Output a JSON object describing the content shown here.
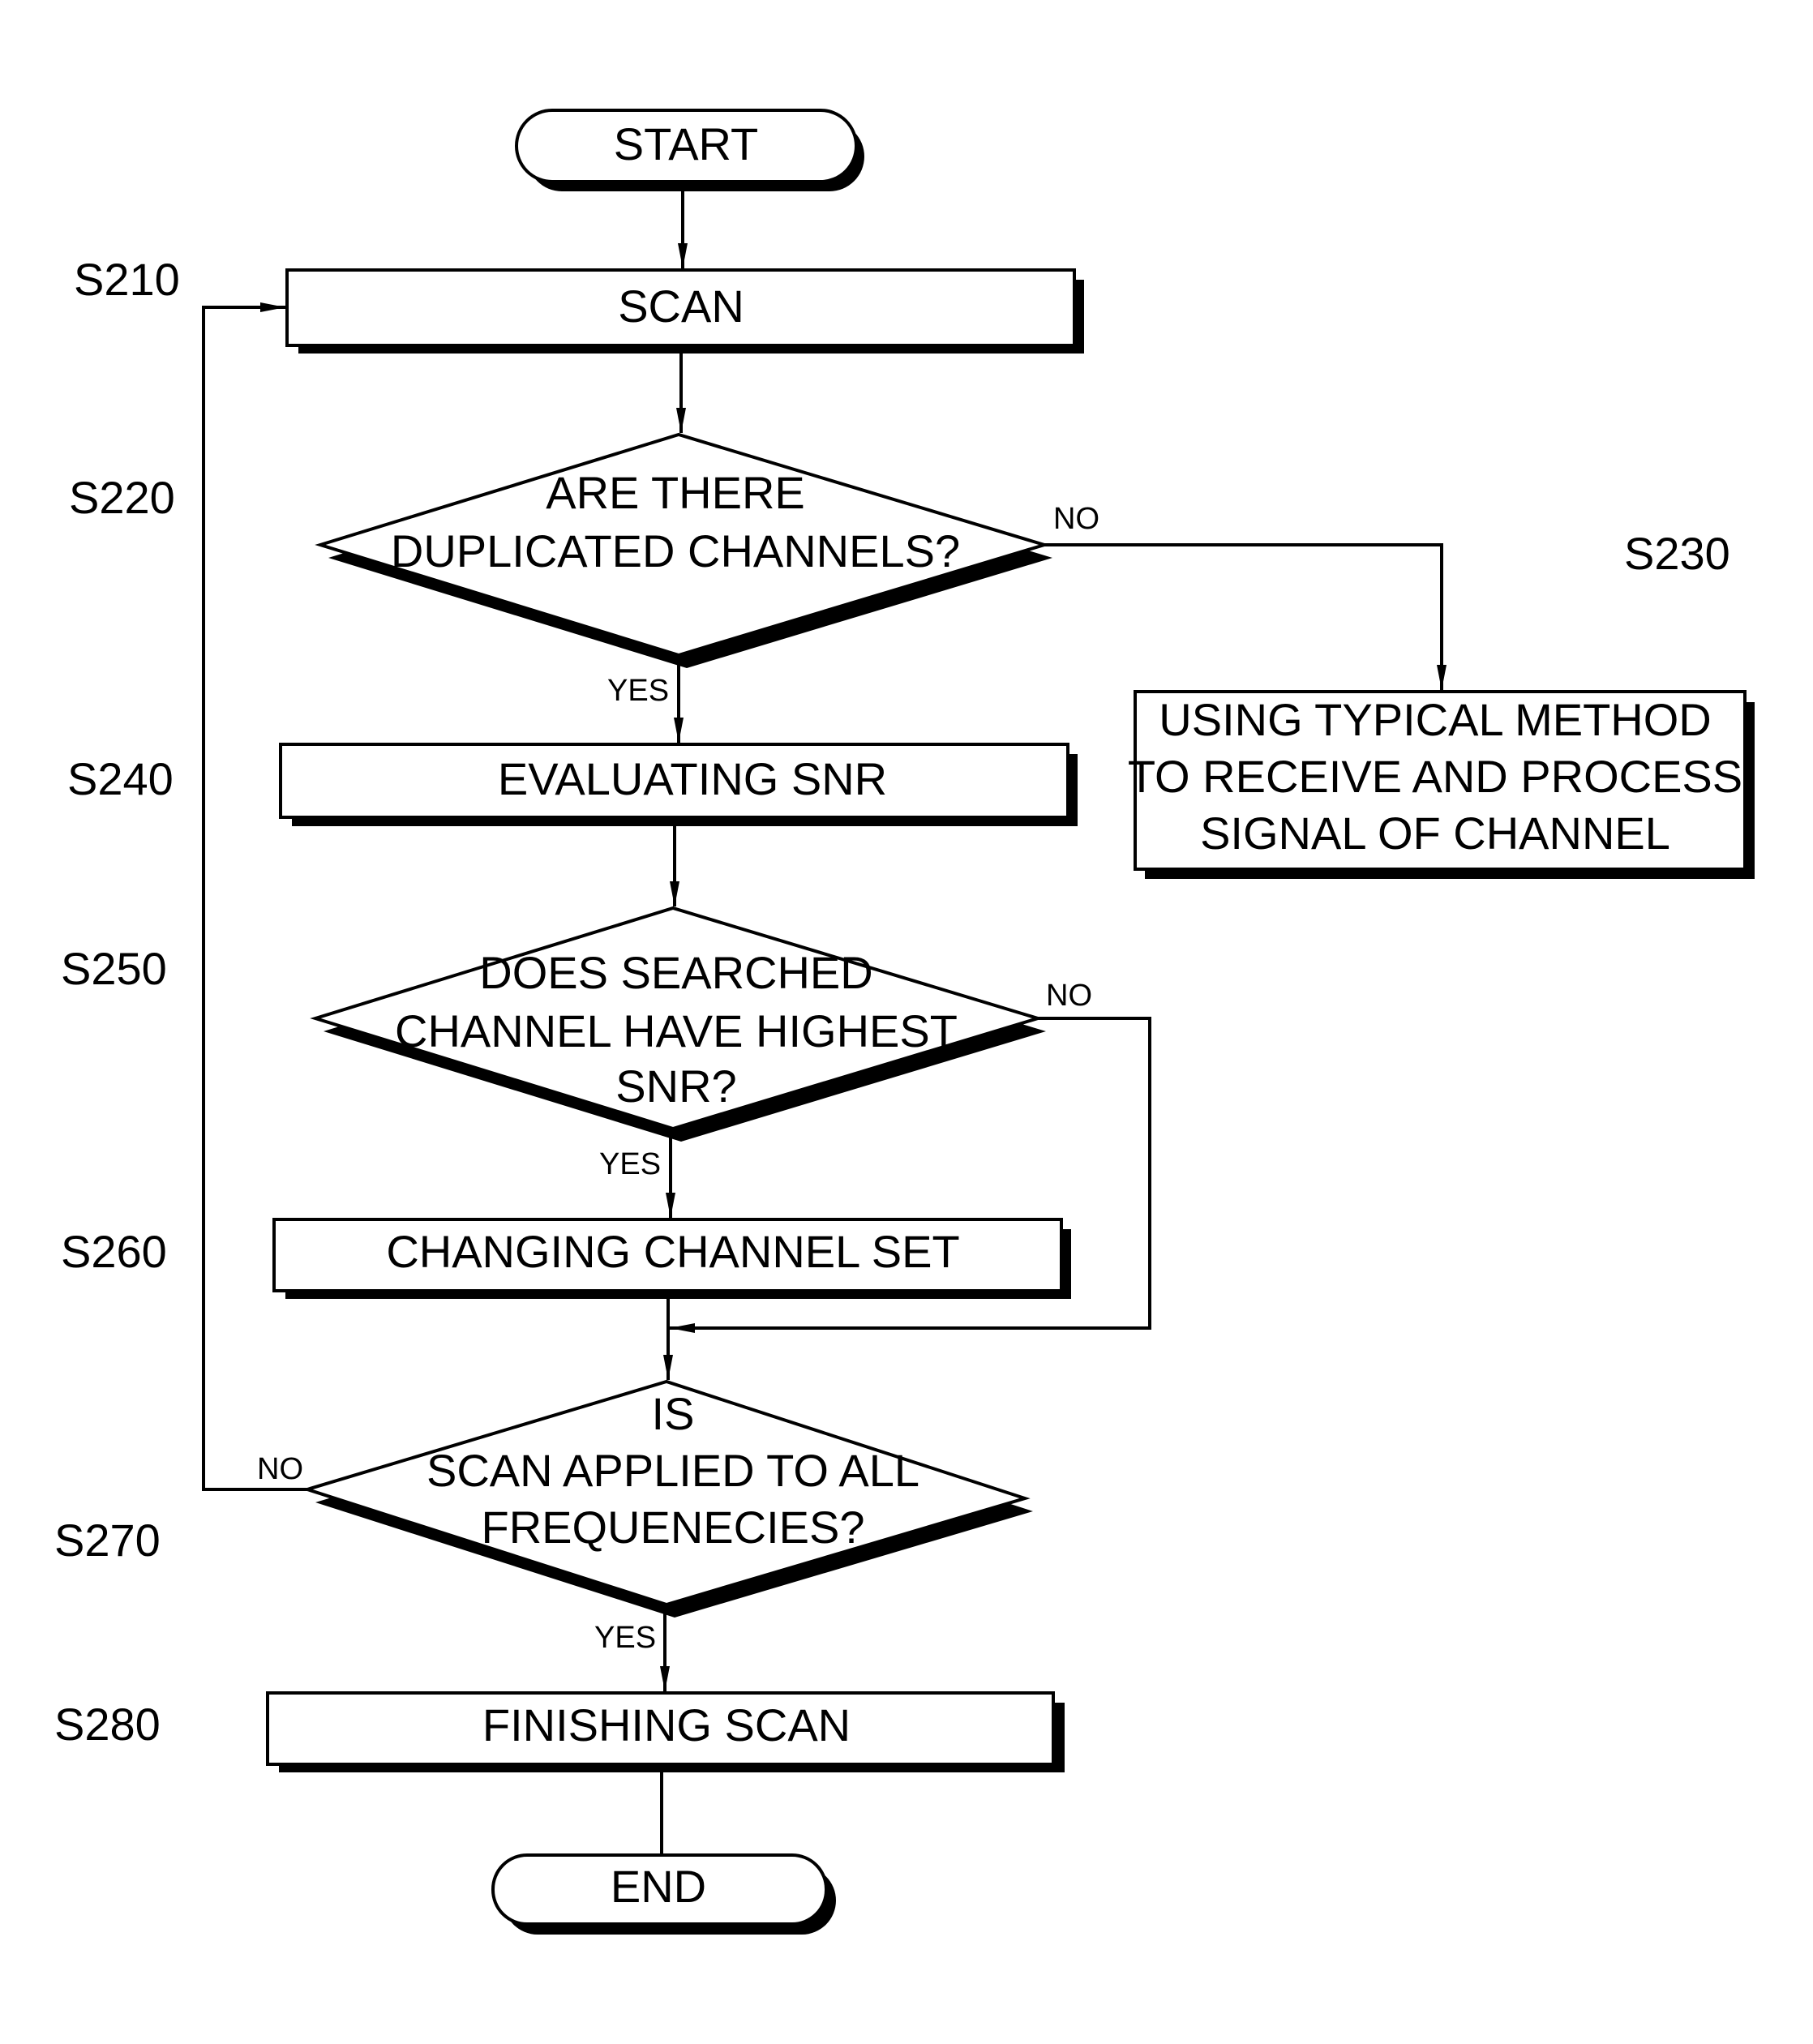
{
  "flowchart": {
    "start": "START",
    "end": "END",
    "steps": [
      {
        "id": "S210",
        "type": "process",
        "lines": [
          "SCAN"
        ]
      },
      {
        "id": "S220",
        "type": "decision",
        "lines": [
          "ARE THERE",
          "DUPLICATED CHANNELS?"
        ],
        "yes": "YES",
        "no": "NO"
      },
      {
        "id": "S230",
        "type": "process",
        "lines": [
          "USING TYPICAL METHOD",
          "TO RECEIVE AND PROCESS",
          "SIGNAL OF CHANNEL"
        ]
      },
      {
        "id": "S240",
        "type": "process",
        "lines": [
          "EVALUATING SNR"
        ]
      },
      {
        "id": "S250",
        "type": "decision",
        "lines": [
          "DOES SEARCHED",
          "CHANNEL HAVE HIGHEST",
          "SNR?"
        ],
        "yes": "YES",
        "no": "NO"
      },
      {
        "id": "S260",
        "type": "process",
        "lines": [
          "CHANGING CHANNEL SET"
        ]
      },
      {
        "id": "S270",
        "type": "decision",
        "lines": [
          "IS",
          "SCAN APPLIED TO ALL",
          "FREQUENECIES?"
        ],
        "yes": "YES",
        "no": "NO"
      },
      {
        "id": "S280",
        "type": "process",
        "lines": [
          "FINISHING SCAN"
        ]
      }
    ]
  }
}
